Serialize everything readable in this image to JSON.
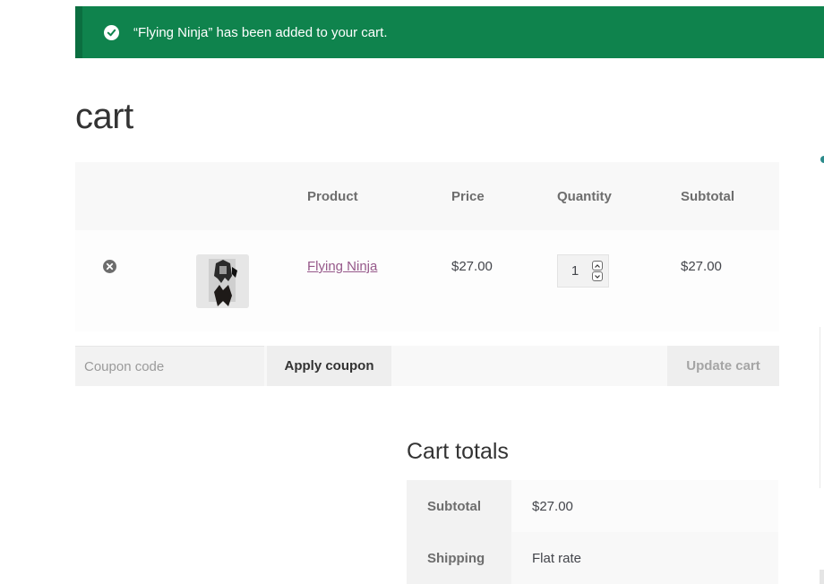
{
  "notice": {
    "message": "“Flying Ninja” has been added to your cart."
  },
  "page": {
    "title": "cart"
  },
  "cart": {
    "columns": {
      "product": "Product",
      "price": "Price",
      "quantity": "Quantity",
      "subtotal": "Subtotal"
    },
    "items": [
      {
        "name": "Flying Ninja",
        "price": "$27.00",
        "quantity": "1",
        "subtotal": "$27.00",
        "thumbnail_icon": "poster-thumbnail"
      }
    ],
    "coupon_placeholder": "Coupon code",
    "apply_coupon_label": "Apply coupon",
    "update_cart_label": "Update cart"
  },
  "totals": {
    "title": "Cart totals",
    "rows": [
      {
        "label": "Subtotal",
        "value": "$27.00"
      },
      {
        "label": "Shipping",
        "value": "Flat rate"
      }
    ]
  },
  "colors": {
    "notice_bg": "#0f834d",
    "link": "#96588a",
    "text": "#43454b"
  }
}
